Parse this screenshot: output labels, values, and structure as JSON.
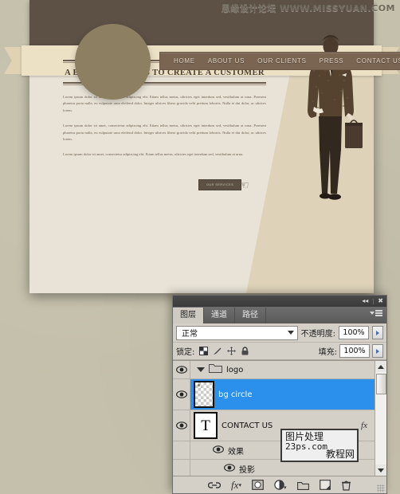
{
  "watermarks": {
    "top_right": "思缘设计论坛 WWW.MISSYUAN.COM",
    "panel_box": {
      "line1": "图片处理",
      "line2": "23ps.com",
      "overlay": "教程网"
    }
  },
  "website_mockup": {
    "nav": {
      "items": [
        {
          "label": "HOME"
        },
        {
          "label": "ABOUT US"
        },
        {
          "label": "OUR CLIENTS"
        },
        {
          "label": "PRESS"
        },
        {
          "label": "CONTACT US"
        }
      ]
    },
    "headline": "A BUSINESS EXISTS TO CREATE A CUSTOMER",
    "paragraphs": [
      "Lorem ipsum dolor sit amet, consectetur adipiscing elit. Etiam tellus metus, ultricies eget interdum sed, vestibulum at urna. Praesent pharetra porta nulla, eu vulputate urna eleifend dolor. Integer ultrices libero gravida velit pretium lobortis. Nulla et dui dolor, ac ultrices lorem.",
      "Lorem ipsum dolor sit amet, consectetur adipiscing elit. Etiam tellus metus, ultricies eget interdum sed, vestibulum at urna. Praesent pharetra porta nulla, eu vulputate urna eleifend dolor. Integer ultrices libero gravida velit pretium lobortis. Nulla et dui dolor, ac ultrices lorem.",
      "Lorem ipsum dolor sit amet, consectetur adipiscing elit. Etiam tellus metus, ultricies eget interdum sed, vestibulum at urna."
    ],
    "cta_label": "OUR SERVICES",
    "colors": {
      "dark_header": "#5d5145",
      "page_bg": "#e9e3d7",
      "ribbon": "#ece0c5",
      "logo_circle": "#8c7f62",
      "nav_bar": "#7a6553"
    }
  },
  "layers_panel": {
    "titlebar": {
      "collapse_icon": "collapse-arrows-icon",
      "close_icon": "close-icon"
    },
    "tabs": [
      {
        "label": "图层",
        "active": true
      },
      {
        "label": "通道",
        "active": false
      },
      {
        "label": "路径",
        "active": false
      }
    ],
    "blend_row": {
      "mode_value": "正常",
      "opacity_label": "不透明度:",
      "opacity_value": "100%"
    },
    "lock_row": {
      "lock_label": "锁定:",
      "lock_icons": [
        "lock-transparency-icon",
        "lock-image-icon",
        "lock-position-icon",
        "lock-all-icon"
      ],
      "fill_label": "填充:",
      "fill_value": "100%"
    },
    "layers": [
      {
        "name": "logo",
        "type": "group",
        "visible": true,
        "selected": false,
        "expanded": true
      },
      {
        "name": "bg circle",
        "type": "pixel",
        "visible": true,
        "selected": true,
        "expanded": false
      },
      {
        "name": "CONTACT US",
        "type": "text",
        "thumb_glyph": "T",
        "visible": true,
        "selected": false,
        "has_fx": true
      },
      {
        "name": "效果",
        "type": "effects-group",
        "visible": true,
        "selected": false
      },
      {
        "name": "投影",
        "type": "effect",
        "visible": true,
        "selected": false
      }
    ],
    "bottom_toolbar": [
      {
        "icon": "link-layers-icon"
      },
      {
        "icon": "layer-style-fx-icon"
      },
      {
        "icon": "add-layer-mask-icon"
      },
      {
        "icon": "adjustment-layer-icon"
      },
      {
        "icon": "new-group-icon"
      },
      {
        "icon": "new-layer-icon"
      },
      {
        "icon": "delete-layer-icon"
      }
    ],
    "colors": {
      "panel_bg": "#d4d0c8",
      "selection_blue": "#2b8fec",
      "titlebar": "#3f3f3f",
      "tab_bar": "#6e6e6e"
    }
  }
}
